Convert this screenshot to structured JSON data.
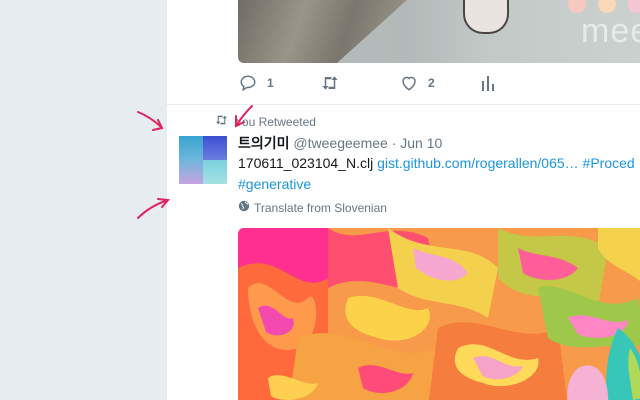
{
  "previous_tweet": {
    "media_watermark": "mee",
    "actions": {
      "reply_count": "1",
      "like_count": "2"
    }
  },
  "retweet_header": {
    "label": "You Retweeted"
  },
  "tweet": {
    "display_name": "트의기미",
    "handle": "@tweegeemee",
    "separator": "·",
    "date": "Jun 10",
    "text_prefix": "170611_023104_N.clj",
    "link_text": "gist.github.com/rogerallen/065…",
    "hashtag_1": "#Proced",
    "hashtag_2": "#generative",
    "translate_label": "Translate from Slovenian"
  },
  "icons": {
    "reply": "reply-icon",
    "retweet": "retweet-icon",
    "like": "heart-icon",
    "analytics": "analytics-icon",
    "globe": "globe-icon"
  },
  "colors": {
    "page_bg": "#e6ecf0",
    "card_bg": "#ffffff",
    "link": "#1b95e0",
    "muted_text": "#657786",
    "annotation": "#e0245e"
  }
}
